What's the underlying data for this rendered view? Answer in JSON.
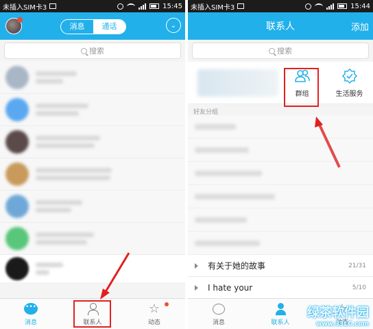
{
  "left": {
    "status": {
      "carrier": "未插入SIM卡3",
      "time": "15:45"
    },
    "header": {
      "seg_messages": "消息",
      "seg_calls": "通话"
    },
    "search": {
      "placeholder": "搜索"
    },
    "tabs": [
      {
        "label": "消息",
        "icon": "chat-bubble-icon"
      },
      {
        "label": "联系人",
        "icon": "person-icon"
      },
      {
        "label": "动态",
        "icon": "star-icon"
      }
    ],
    "avatar_colors": [
      "#a9b6c6",
      "#5aa8ef",
      "#5a4a4a",
      "#c89b5c",
      "#6fa8d8",
      "#58c77a"
    ]
  },
  "right": {
    "status": {
      "carrier": "未插入SIM卡3",
      "time": "15:44"
    },
    "header": {
      "title": "联系人",
      "add": "添加"
    },
    "search": {
      "placeholder": "搜索"
    },
    "features": [
      {
        "label": "群组",
        "icon": "group-icon"
      },
      {
        "label": "生活服务",
        "icon": "life-service-icon"
      }
    ],
    "section_title": "好友分组",
    "groups": [
      {
        "name": "有关于她的故事",
        "count": "21/31"
      },
      {
        "name": "I hate your",
        "count": "5/10"
      }
    ],
    "tabs": [
      {
        "label": "消息",
        "icon": "chat-bubble-icon"
      },
      {
        "label": "联系人",
        "icon": "person-icon"
      },
      {
        "label": "动态",
        "icon": "star-icon"
      }
    ]
  },
  "watermark": {
    "brand": "绿茶软件园",
    "site": "www.33LC.com"
  },
  "colors": {
    "accent": "#22b0ea",
    "highlight": "#e02020"
  }
}
